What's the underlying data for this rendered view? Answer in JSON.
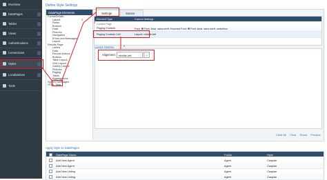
{
  "sidebar": {
    "items": [
      {
        "label": "Overview",
        "icon": "overview-icon"
      },
      {
        "label": "DataPages",
        "icon": "datapages-icon"
      },
      {
        "label": "Tables",
        "icon": "tables-icon"
      },
      {
        "label": "Views",
        "icon": "views-icon"
      },
      {
        "label": "Authentications",
        "icon": "authentications-icon"
      },
      {
        "label": "Connections",
        "icon": "connections-icon"
      },
      {
        "label": "Styles",
        "icon": "styles-icon"
      },
      {
        "label": "Localizations",
        "icon": "localizations-icon"
      },
      {
        "label": "Tools",
        "icon": "tools-icon"
      }
    ]
  },
  "page": {
    "title": "Define Style Settings"
  },
  "tree": {
    "header": "DataPage Elements",
    "nodes": [
      "Forms/Details",
      "Labels",
      "Fields",
      "Buttons",
      "Data",
      "Pictures",
      "Navigation",
      "Errors and Messages",
      "Layout",
      "Results Page",
      "Labels",
      "Data",
      "Record Actions",
      "Buttons",
      "Table Layout",
      "Grid Layout",
      "Gallery Layout",
      "Pictures",
      "Paging",
      "Totals",
      "Aggregations",
      "System Messages",
      "HTML Tags"
    ]
  },
  "tabs": {
    "settings": "Settings",
    "source": "Source"
  },
  "grid": {
    "headers": [
      "Element Type",
      "Current Settings"
    ],
    "rows": [
      [
        "Paging Controls",
        "Font: ✖ Font: Arial, sans-serif; Hovered Font: ✖ Font: Arial, sans-serif; underline;"
      ],
      [
        "Paging Controls Cell",
        "Layout: middle-left"
      ]
    ]
  },
  "layout_options": {
    "title": "Layout Options",
    "alignment_label": "Alignment:",
    "alignment_value": "middle-left",
    "dots": "..."
  },
  "footer": {
    "links": [
      "Clear All",
      "Clear",
      "Reset",
      "Preview"
    ]
  },
  "apply": {
    "title": "Apply Style to DataPages",
    "headers": [
      "DataPage Name",
      "Folder",
      "Style"
    ],
    "rows": [
      [
        "Add New Agent",
        "Agent",
        "Caspian"
      ],
      [
        "Add New Agent",
        "Agent",
        "Caspian"
      ],
      [
        "Add New Listing",
        "Agent",
        "Caspian"
      ],
      [
        "Add New Listing",
        "Agent",
        "Caspian"
      ]
    ]
  },
  "annotations": {
    "numbers": [
      "2",
      "3",
      "4"
    ]
  }
}
